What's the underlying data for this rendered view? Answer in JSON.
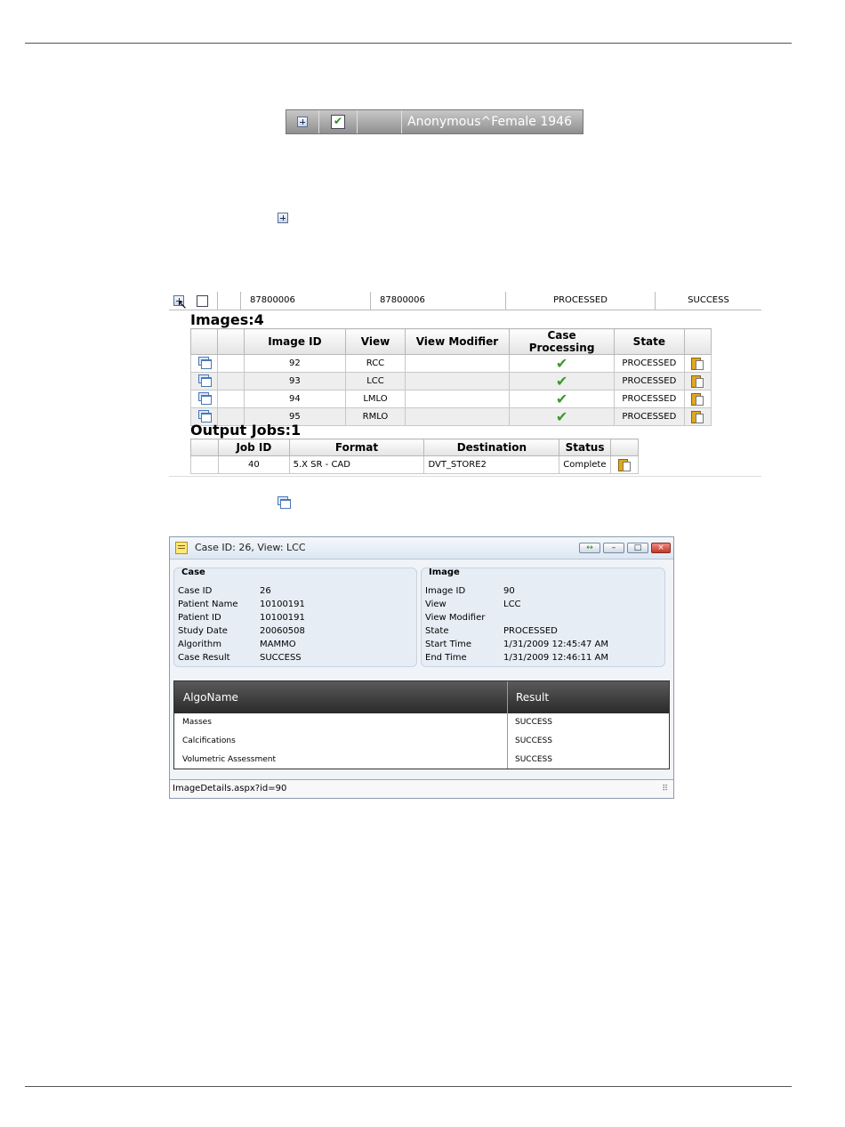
{
  "patient_row": {
    "name": "Anonymous^Female 1946"
  },
  "study": {
    "row": {
      "col1": "87800006",
      "col2": "87800006",
      "col3": "PROCESSED",
      "col4": "SUCCESS"
    },
    "images_heading": "Images:4",
    "images_columns": [
      "Image ID",
      "View",
      "View Modifier",
      "Case Processing",
      "State"
    ],
    "images": [
      {
        "id": "92",
        "view": "RCC",
        "modifier": "",
        "processing": "✔",
        "state": "PROCESSED"
      },
      {
        "id": "93",
        "view": "LCC",
        "modifier": "",
        "processing": "✔",
        "state": "PROCESSED"
      },
      {
        "id": "94",
        "view": "LMLO",
        "modifier": "",
        "processing": "✔",
        "state": "PROCESSED"
      },
      {
        "id": "95",
        "view": "RMLO",
        "modifier": "",
        "processing": "✔",
        "state": "PROCESSED"
      }
    ],
    "jobs_heading": "Output Jobs:1",
    "jobs_columns": [
      "Job ID",
      "Format",
      "Destination",
      "Status"
    ],
    "jobs": [
      {
        "id": "40",
        "format": "5.X SR - CAD",
        "destination": "DVT_STORE2",
        "status": "Complete"
      }
    ]
  },
  "popup": {
    "title": "Case ID: 26, View: LCC",
    "case": {
      "legend": "Case",
      "labels": [
        "Case ID",
        "Patient Name",
        "Patient ID",
        "Study Date",
        "Algorithm",
        "Case Result"
      ],
      "values": [
        "26",
        "10100191",
        "10100191",
        "20060508",
        "MAMMO",
        "SUCCESS"
      ]
    },
    "image": {
      "legend": "Image",
      "labels": [
        "Image ID",
        "View",
        "View Modifier",
        "State",
        "Start Time",
        "End Time"
      ],
      "values": [
        "90",
        "LCC",
        "",
        "PROCESSED",
        "1/31/2009 12:45:47 AM",
        "1/31/2009 12:46:11 AM"
      ]
    },
    "algo_columns": [
      "AlgoName",
      "Result"
    ],
    "algo_rows": [
      {
        "name": "Masses",
        "result": "SUCCESS"
      },
      {
        "name": "Calcifications",
        "result": "SUCCESS"
      },
      {
        "name": "Volumetric Assessment",
        "result": "SUCCESS"
      }
    ],
    "status": "ImageDetails.aspx?id=90"
  },
  "colors": {
    "check": "#3a9a2a",
    "header_gray": "#8f8f8f",
    "algo_header": "#2a2a2a"
  }
}
